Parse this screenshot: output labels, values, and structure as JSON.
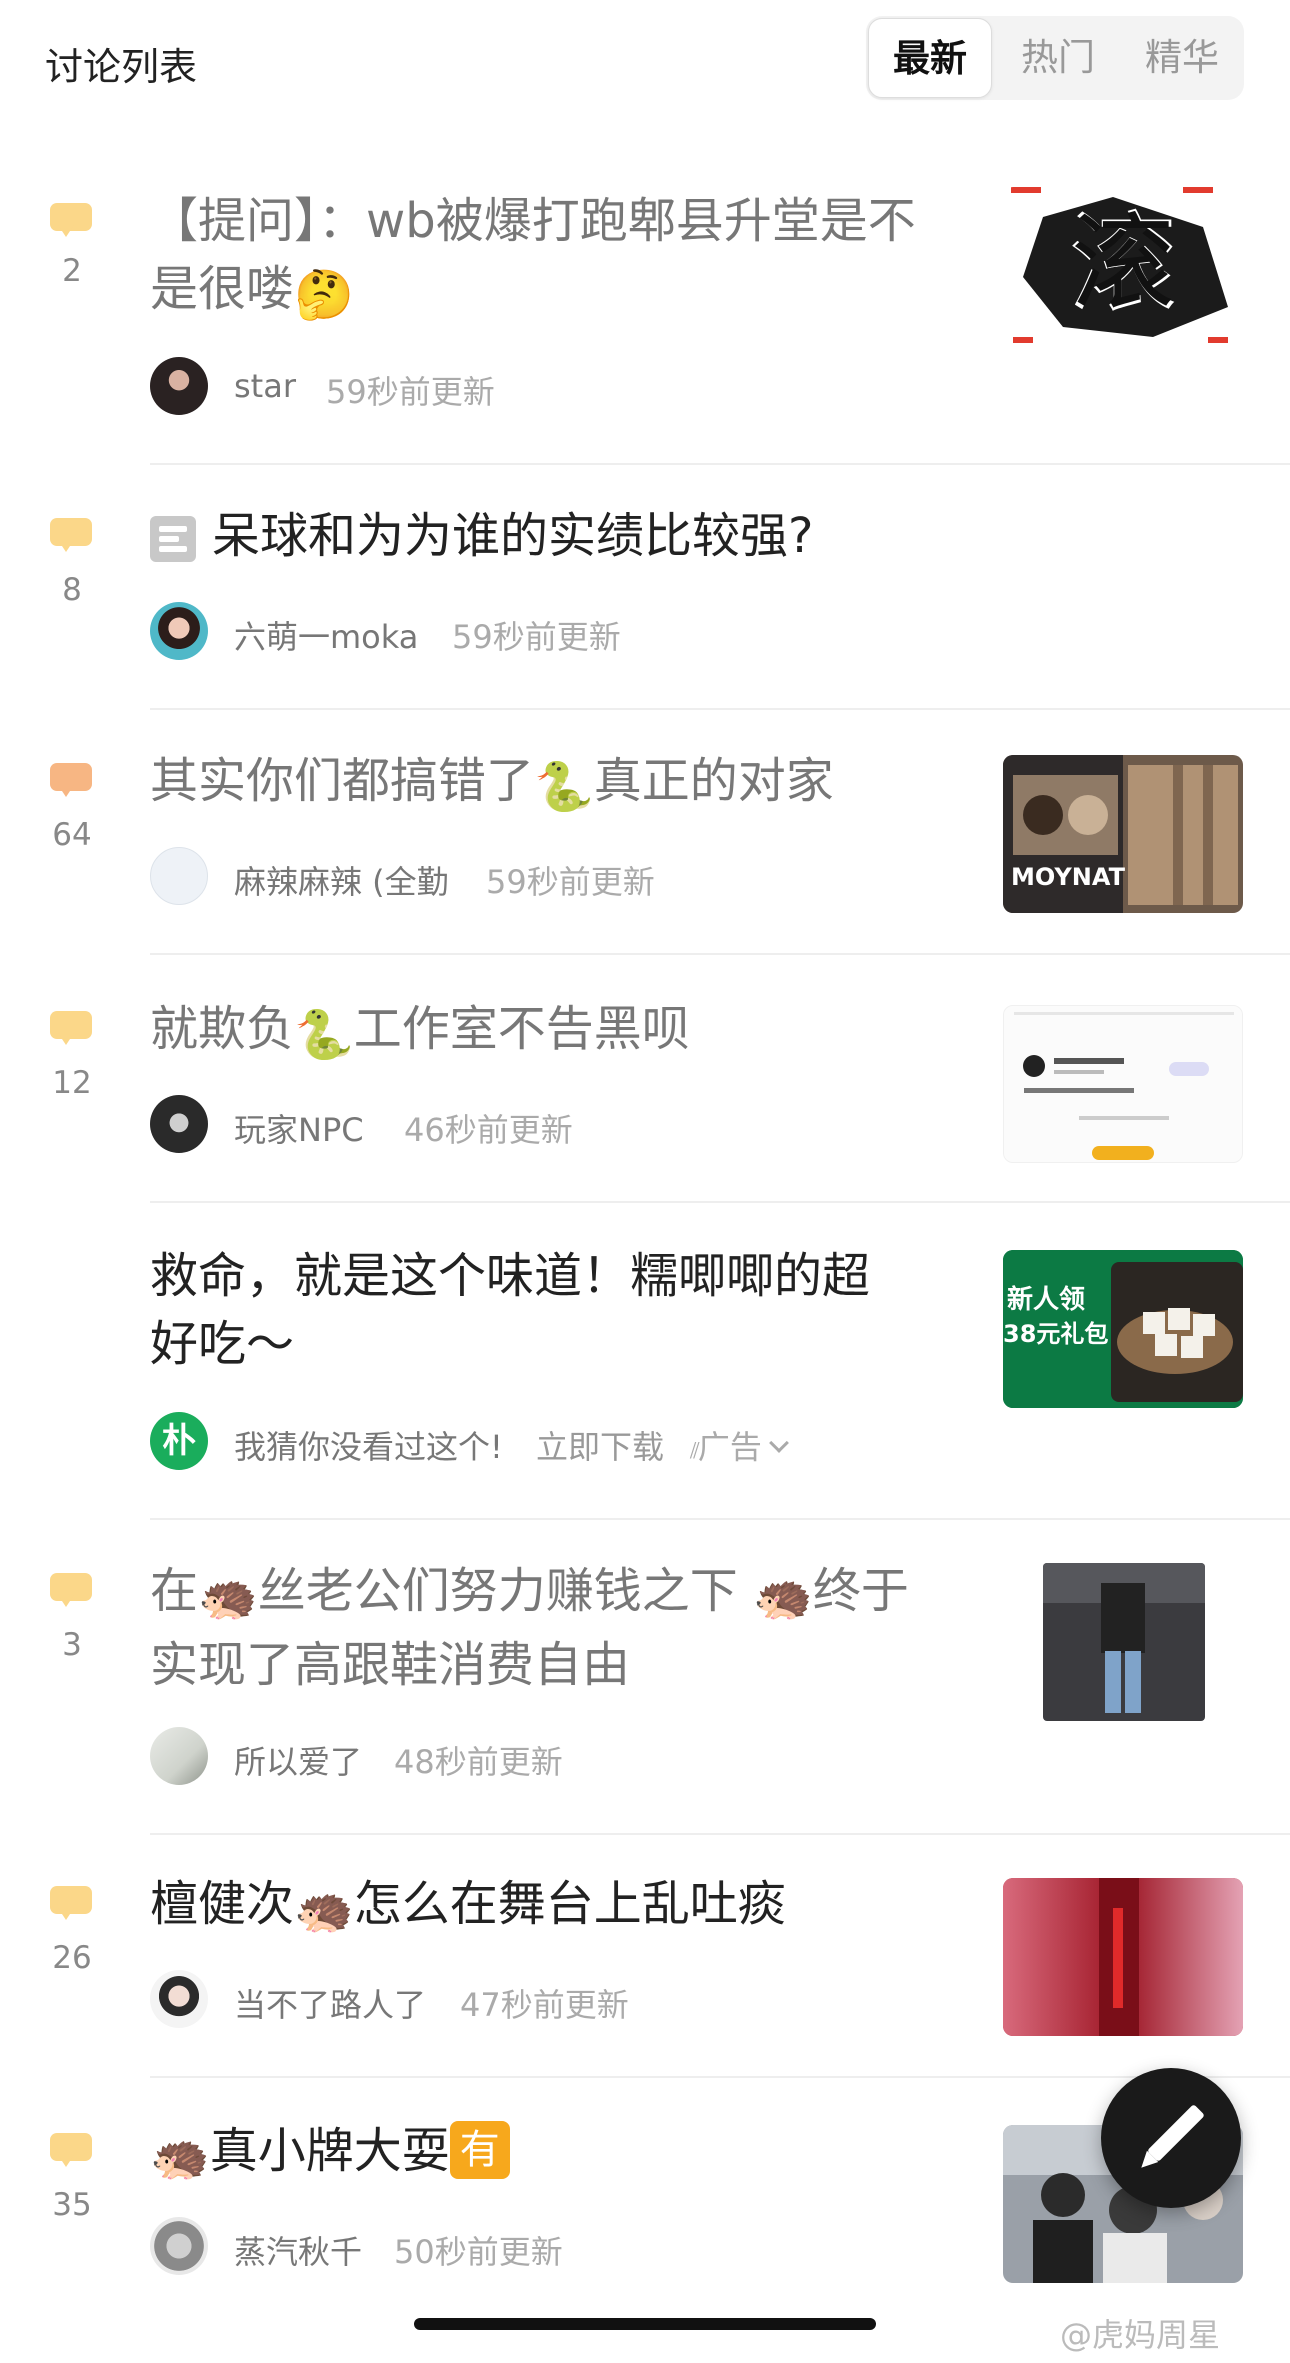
{
  "header": {
    "title": "讨论列表",
    "tabs": [
      {
        "label": "最新",
        "active": true
      },
      {
        "label": "热门",
        "active": false
      },
      {
        "label": "精华",
        "active": false
      }
    ]
  },
  "posts": [
    {
      "comment_count": "2",
      "title_line1": "【提问】：wb被爆打跑郫县升堂是不",
      "title_line2": "是很喽",
      "title_emoji": "🤔",
      "username": "star",
      "time": "59秒前更新",
      "thumbnail": "text image with character 滚"
    },
    {
      "comment_count": "8",
      "title": "呆球和为为谁的实绩比较强?",
      "username": "六萌一moka",
      "time": "59秒前更新"
    },
    {
      "comment_count": "64",
      "title_a": "其实你们都搞错了",
      "title_emoji": "🐍",
      "title_b": "真正的对家",
      "username": "麻辣麻辣 (全勤",
      "time": "59秒前更新",
      "thumbnail_text": "MOYNAT"
    },
    {
      "comment_count": "12",
      "title_a": "就欺负",
      "title_emoji": "🐍",
      "title_b": "工作室不告黑呗",
      "username": "玩家NPC",
      "time": "46秒前更新"
    },
    {
      "ad": true,
      "title_line1": "救命，就是这个味道！糯唧唧的超",
      "title_line2": "好吃～",
      "advertiser_logo_char": "朴",
      "username": "我猜你没看过这个!",
      "cta": "立即下载",
      "ad_label": "广告",
      "thumbnail_line1": "新人领",
      "thumbnail_line2": "38元礼包"
    },
    {
      "comment_count": "3",
      "title_a": "在",
      "title_emoji": "🦔",
      "title_b": "丝老公们努力赚钱之下 ",
      "title_c": "终于",
      "title_line2": "实现了高跟鞋消费自由",
      "username": "所以爱了",
      "time": "48秒前更新"
    },
    {
      "comment_count": "26",
      "title_a": "檀健次",
      "title_emoji": "🦔",
      "title_b": "怎么在舞台上乱吐痰",
      "username": "当不了路人了",
      "time": "47秒前更新"
    },
    {
      "comment_count": "35",
      "title_emoji": "🦔",
      "title_b": "真小牌大耍",
      "title_badge": "有",
      "username": "蒸汽秋千",
      "time": "50秒前更新"
    }
  ],
  "watermark": "@虎妈周星",
  "colors": {
    "comment_icon": "#fbd789",
    "comment_icon_hot": "#f7b683",
    "ad_logo": "#1aad5c"
  }
}
